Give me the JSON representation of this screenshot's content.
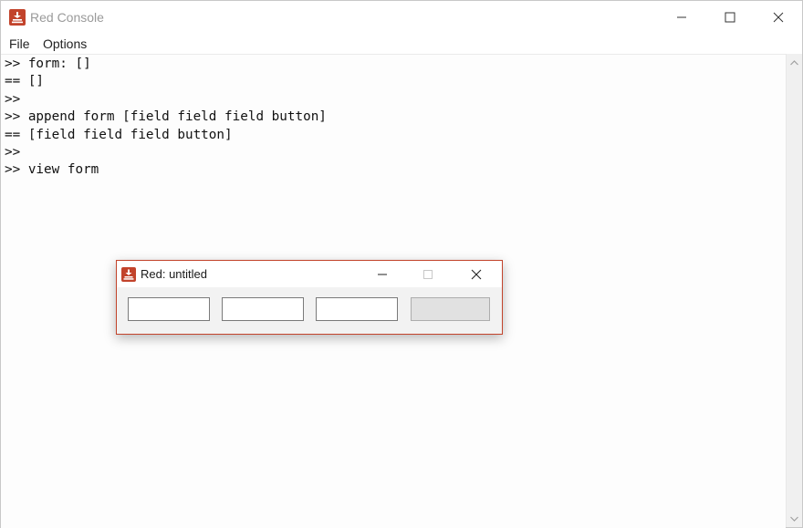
{
  "main_window": {
    "title": "Red Console",
    "icons": [
      "app-icon",
      "minimize-icon",
      "maximize-icon",
      "close-icon"
    ]
  },
  "menu": {
    "items": [
      {
        "label": "File"
      },
      {
        "label": "Options"
      }
    ]
  },
  "console": {
    "lines": [
      ">> form: []",
      "== []",
      ">>",
      ">> append form [field field field button]",
      "== [field field field button]",
      ">>",
      ">> view form"
    ]
  },
  "child_window": {
    "title": "Red: untitled",
    "fields": [
      "",
      "",
      ""
    ],
    "button_label": "",
    "accent": "#c2432b"
  },
  "colors": {
    "accent": "#c2432b",
    "console_background": "#fdfdfd",
    "title_text": "#9a9a9a"
  }
}
